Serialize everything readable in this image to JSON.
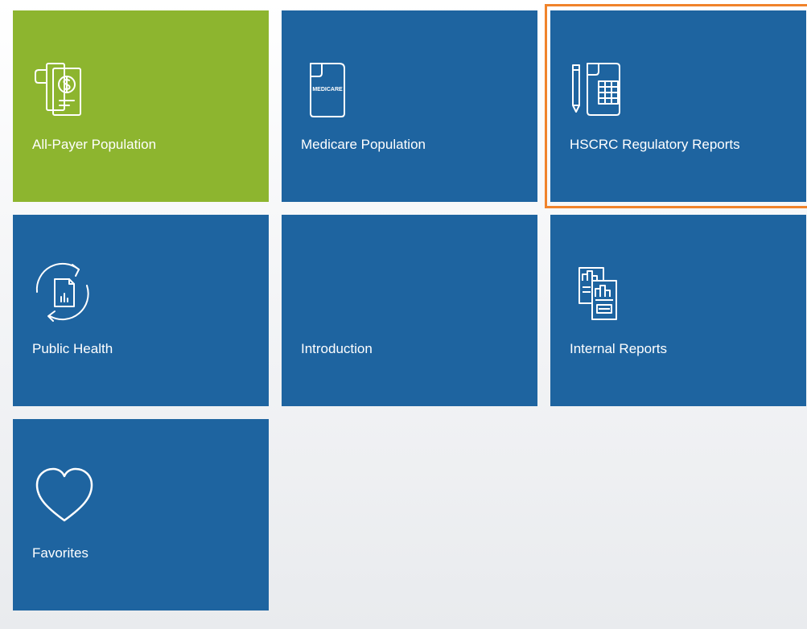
{
  "tiles": [
    {
      "label": "All-Payer Population",
      "icon": "dollar-document-icon",
      "color": "#8db52f"
    },
    {
      "label": "Medicare Population",
      "icon": "medicare-document-icon",
      "color": "#1e64a0",
      "icon_text": "MEDICARE"
    },
    {
      "label": "HSCRC Regulatory Reports",
      "icon": "pencil-spreadsheet-icon",
      "color": "#1e64a0",
      "selected": true
    },
    {
      "label": "Public Health",
      "icon": "refresh-report-icon",
      "color": "#1e64a0"
    },
    {
      "label": "Introduction",
      "icon": "",
      "color": "#1e64a0"
    },
    {
      "label": "Internal Reports",
      "icon": "bar-chart-reports-icon",
      "color": "#1e64a0"
    },
    {
      "label": "Favorites",
      "icon": "heart-icon",
      "color": "#1e64a0"
    }
  ],
  "colors": {
    "tile_blue": "#1e64a0",
    "tile_green": "#8db52f",
    "selection_outline": "#f0832b"
  }
}
